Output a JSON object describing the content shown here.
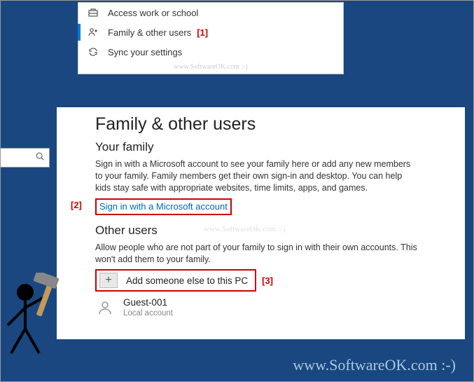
{
  "nav": {
    "items": [
      {
        "label": "Access work or school"
      },
      {
        "label": "Family & other users",
        "annotation": "[1]"
      },
      {
        "label": "Sync your settings"
      }
    ],
    "watermark": "www.SoftwareOK.com :-)"
  },
  "page": {
    "title": "Family & other users",
    "family": {
      "heading": "Your family",
      "desc": "Sign in with a Microsoft account to see your family here or add any new members to your family. Family members get their own sign-in and desktop. You can help kids stay safe with appropriate websites, time limits, apps, and games.",
      "link": "Sign in with a Microsoft account",
      "annotation": "[2]"
    },
    "other": {
      "heading": "Other users",
      "desc": "Allow people who are not part of your family to sign in with their own accounts. This won't add them to your family.",
      "add_label": "Add someone else to this PC",
      "annotation": "[3]",
      "watermark": "www.SoftwareOK.com :-)"
    },
    "user": {
      "name": "Guest-001",
      "sub": "Local account"
    }
  },
  "bottom_watermark": "www.SoftwareOK.com :-)"
}
